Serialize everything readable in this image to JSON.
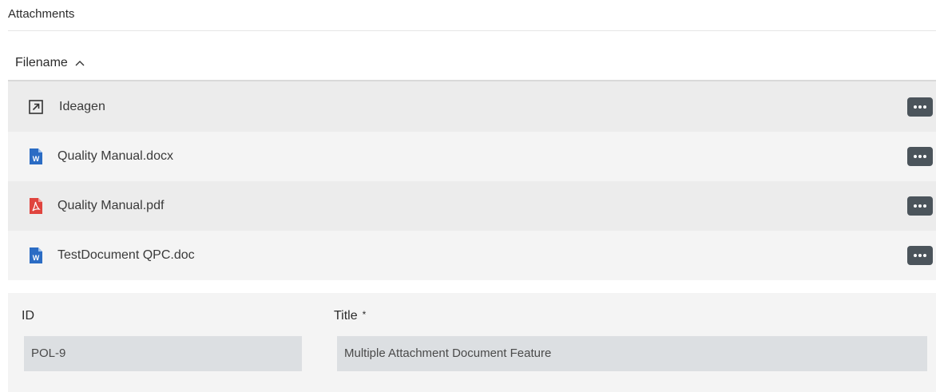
{
  "section": {
    "title": "Attachments"
  },
  "table": {
    "column_header": "Filename",
    "sort_direction": "ascending",
    "rows": [
      {
        "name": "Ideagen",
        "icon": "external-link-icon"
      },
      {
        "name": "Quality Manual.docx",
        "icon": "word-document-icon"
      },
      {
        "name": "Quality Manual.pdf",
        "icon": "pdf-document-icon"
      },
      {
        "name": "TestDocument QPC.doc",
        "icon": "word-document-icon"
      }
    ]
  },
  "form": {
    "id_label": "ID",
    "id_value": "POL-9",
    "title_label": "Title",
    "title_required_marker": "*",
    "title_value": "Multiple Attachment Document Feature"
  },
  "colors": {
    "action_button": "#4b545b",
    "word_icon": "#2b6cc4",
    "pdf_icon": "#e0443e"
  }
}
